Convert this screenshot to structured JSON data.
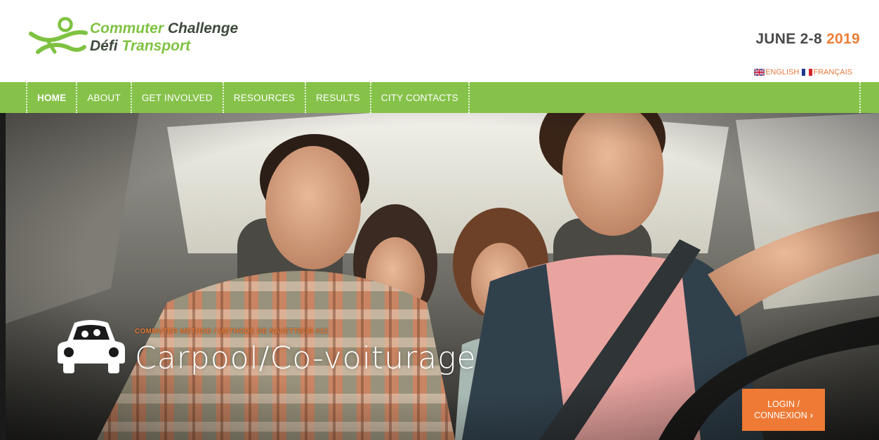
{
  "header": {
    "logo_line1_a": "Commuter",
    "logo_line1_b": " Challenge",
    "logo_line2_a": "Défi ",
    "logo_line2_b": "Transport",
    "dates_prefix": "JUNE 2-8 ",
    "dates_year": "2019"
  },
  "language": {
    "english": "ENGLISH",
    "french": "FRANÇAIS"
  },
  "nav": {
    "items": [
      {
        "label": "HOME",
        "active": true
      },
      {
        "label": "ABOUT"
      },
      {
        "label": "GET INVOLVED"
      },
      {
        "label": "RESOURCES"
      },
      {
        "label": "RESULTS"
      },
      {
        "label": "CITY CONTACTS"
      }
    ]
  },
  "hero": {
    "kicker": "COMMUTER METHOD / METHODE DE NAVETTEUR #12",
    "title": "Carpool/Co-voiturage",
    "login_line1": "LOGIN /",
    "login_line2": "CONNEXION",
    "login_chevron": "›"
  },
  "colors": {
    "brand_green": "#7fc242",
    "nav_green": "#86c24a",
    "accent_orange": "#ee7a35",
    "dark_text": "#4a4a4a"
  },
  "icons": {
    "logo": "commuter-runner-logo",
    "carpool": "car-front-icon",
    "uk_flag": "uk-flag-icon",
    "fr_flag": "france-flag-icon"
  }
}
